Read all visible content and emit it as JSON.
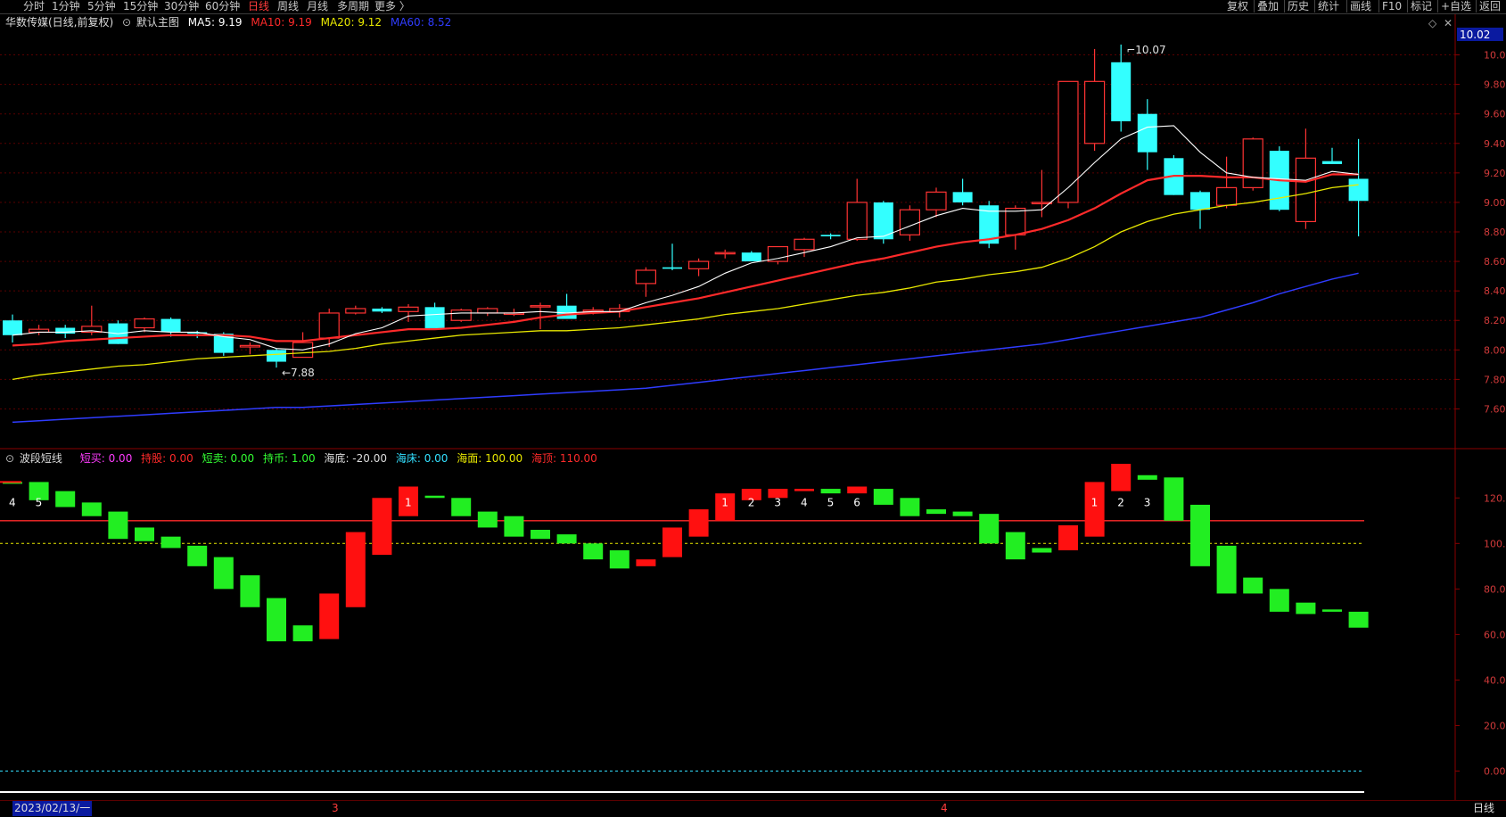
{
  "toolbar": {
    "left_tabs": [
      "分时",
      "1分钟",
      "5分钟",
      "15分钟",
      "30分钟",
      "60分钟",
      "日线",
      "周线",
      "月线",
      "多周期",
      "更多 〉"
    ],
    "active_tab": "日线",
    "right_tabs": [
      "复权",
      "叠加",
      "历史",
      "统计",
      "画线",
      "F10",
      "标记",
      "+自选",
      "返回"
    ]
  },
  "main_header": {
    "stock": "华数传媒(日线,前复权)",
    "template": "默认主图",
    "ma": [
      {
        "name": "MA5",
        "value": "9.19",
        "color": "#ffffff"
      },
      {
        "name": "MA10",
        "value": "9.19",
        "color": "#ff2a2a"
      },
      {
        "name": "MA20",
        "value": "9.12",
        "color": "#e8e800"
      },
      {
        "name": "MA60",
        "value": "8.52",
        "color": "#2f3cff"
      }
    ]
  },
  "sub_header": {
    "name": "波段短线",
    "items": [
      {
        "name": "短买",
        "value": "0.00",
        "color": "#ff3cff"
      },
      {
        "name": "持股",
        "value": "0.00",
        "color": "#ff2a2a"
      },
      {
        "name": "短卖",
        "value": "0.00",
        "color": "#33ff33"
      },
      {
        "name": "持币",
        "value": "1.00",
        "color": "#33ff33"
      },
      {
        "name": "海底",
        "value": "-20.00",
        "color": "#dddddd"
      },
      {
        "name": "海床",
        "value": "0.00",
        "color": "#33e0ff"
      },
      {
        "name": "海面",
        "value": "100.00",
        "color": "#e8e800"
      },
      {
        "name": "海顶",
        "value": "110.00",
        "color": "#ff2a2a"
      }
    ]
  },
  "price_badge": "10.02",
  "bottom": {
    "date_label": "2023/02/13/一",
    "month_labels": [
      "3",
      "4"
    ],
    "period_label": "日线"
  },
  "colors": {
    "up": "#ff3333",
    "down": "#33ffff",
    "bg": "#000000",
    "axis": "#8a0000",
    "grid": "#5a0000"
  },
  "chart_data": [
    {
      "type": "candlestick",
      "ylim": [
        7.5,
        10.1
      ],
      "yticks": [
        10.0,
        9.8,
        9.6,
        9.4,
        9.2,
        9.0,
        8.8,
        8.6,
        8.4,
        8.2,
        8.0,
        7.8,
        7.6
      ],
      "annotations": [
        {
          "text": "10.07",
          "index": 42
        },
        {
          "text": "7.88",
          "index": 10
        }
      ],
      "ohlc": [
        [
          8.2,
          8.24,
          8.05,
          8.1
        ],
        [
          8.12,
          8.17,
          8.1,
          8.14
        ],
        [
          8.15,
          8.17,
          8.08,
          8.11
        ],
        [
          8.12,
          8.3,
          8.1,
          8.16
        ],
        [
          8.18,
          8.2,
          8.04,
          8.04
        ],
        [
          8.15,
          8.22,
          8.12,
          8.21
        ],
        [
          8.21,
          8.22,
          8.09,
          8.12
        ],
        [
          8.12,
          8.13,
          8.08,
          8.11
        ],
        [
          8.11,
          8.12,
          7.96,
          7.98
        ],
        [
          8.02,
          8.05,
          7.97,
          8.03
        ],
        [
          8.0,
          8.01,
          7.88,
          7.92
        ],
        [
          7.95,
          8.12,
          7.95,
          8.05
        ],
        [
          8.08,
          8.28,
          8.02,
          8.25
        ],
        [
          8.25,
          8.3,
          8.24,
          8.28
        ],
        [
          8.28,
          8.29,
          8.25,
          8.26
        ],
        [
          8.26,
          8.31,
          8.19,
          8.29
        ],
        [
          8.29,
          8.32,
          8.14,
          8.14
        ],
        [
          8.2,
          8.28,
          8.19,
          8.27
        ],
        [
          8.25,
          8.29,
          8.23,
          8.28
        ],
        [
          8.25,
          8.28,
          8.23,
          8.25
        ],
        [
          8.3,
          8.32,
          8.14,
          8.3
        ],
        [
          8.3,
          8.38,
          8.24,
          8.21
        ],
        [
          8.26,
          8.29,
          8.24,
          8.27
        ],
        [
          8.26,
          8.31,
          8.22,
          8.28
        ],
        [
          8.45,
          8.56,
          8.36,
          8.54
        ],
        [
          8.56,
          8.72,
          8.54,
          8.55
        ],
        [
          8.55,
          8.62,
          8.5,
          8.6
        ],
        [
          8.66,
          8.68,
          8.62,
          8.66
        ],
        [
          8.66,
          8.67,
          8.61,
          8.6
        ],
        [
          8.6,
          8.7,
          8.58,
          8.7
        ],
        [
          8.68,
          8.76,
          8.63,
          8.75
        ],
        [
          8.78,
          8.79,
          8.75,
          8.77
        ],
        [
          8.75,
          9.16,
          8.74,
          9.0
        ],
        [
          9.0,
          9.01,
          8.72,
          8.75
        ],
        [
          8.78,
          8.98,
          8.74,
          8.95
        ],
        [
          8.95,
          9.1,
          8.9,
          9.07
        ],
        [
          9.07,
          9.16,
          8.98,
          9.0
        ],
        [
          8.98,
          9.01,
          8.69,
          8.72
        ],
        [
          8.78,
          8.98,
          8.68,
          8.96
        ],
        [
          9.0,
          9.22,
          8.9,
          9.0
        ],
        [
          9.0,
          9.76,
          8.96,
          9.82
        ],
        [
          9.4,
          10.04,
          9.35,
          9.82
        ],
        [
          9.95,
          10.07,
          9.48,
          9.55
        ],
        [
          9.6,
          9.7,
          9.22,
          9.34
        ],
        [
          9.3,
          9.32,
          9.05,
          9.05
        ],
        [
          9.07,
          9.08,
          8.82,
          8.95
        ],
        [
          8.98,
          9.31,
          8.96,
          9.1
        ],
        [
          9.1,
          9.44,
          9.08,
          9.43
        ],
        [
          9.35,
          9.38,
          8.94,
          8.95
        ],
        [
          8.87,
          9.5,
          8.82,
          9.3
        ],
        [
          9.28,
          9.37,
          9.26,
          9.26
        ],
        [
          9.16,
          9.43,
          8.77,
          9.01
        ]
      ],
      "ma5": [
        8.1,
        8.12,
        8.12,
        8.13,
        8.11,
        8.13,
        8.12,
        8.12,
        8.09,
        8.07,
        8.01,
        8.0,
        8.04,
        8.11,
        8.15,
        8.23,
        8.24,
        8.25,
        8.25,
        8.25,
        8.26,
        8.25,
        8.26,
        8.26,
        8.32,
        8.37,
        8.43,
        8.52,
        8.59,
        8.62,
        8.66,
        8.7,
        8.76,
        8.77,
        8.84,
        8.91,
        8.96,
        8.94,
        8.94,
        8.95,
        9.1,
        9.27,
        9.43,
        9.51,
        9.52,
        9.34,
        9.2,
        9.17,
        9.16,
        9.15,
        9.21,
        9.19
      ],
      "ma10": [
        8.03,
        8.04,
        8.06,
        8.07,
        8.08,
        8.09,
        8.1,
        8.1,
        8.1,
        8.09,
        8.06,
        8.06,
        8.08,
        8.1,
        8.12,
        8.14,
        8.14,
        8.15,
        8.17,
        8.19,
        8.22,
        8.24,
        8.25,
        8.26,
        8.29,
        8.32,
        8.35,
        8.39,
        8.43,
        8.47,
        8.51,
        8.55,
        8.59,
        8.62,
        8.66,
        8.7,
        8.73,
        8.75,
        8.78,
        8.82,
        8.88,
        8.96,
        9.06,
        9.15,
        9.18,
        9.18,
        9.17,
        9.17,
        9.15,
        9.14,
        9.19,
        9.19
      ],
      "ma20": [
        7.8,
        7.83,
        7.85,
        7.87,
        7.89,
        7.9,
        7.92,
        7.94,
        7.95,
        7.96,
        7.97,
        7.98,
        7.99,
        8.01,
        8.04,
        8.06,
        8.08,
        8.1,
        8.11,
        8.12,
        8.13,
        8.13,
        8.14,
        8.15,
        8.17,
        8.19,
        8.21,
        8.24,
        8.26,
        8.28,
        8.31,
        8.34,
        8.37,
        8.39,
        8.42,
        8.46,
        8.48,
        8.51,
        8.53,
        8.56,
        8.62,
        8.7,
        8.8,
        8.87,
        8.92,
        8.95,
        8.98,
        9.0,
        9.03,
        9.06,
        9.1,
        9.12
      ],
      "ma60": [
        7.51,
        7.52,
        7.53,
        7.54,
        7.55,
        7.56,
        7.57,
        7.58,
        7.59,
        7.6,
        7.61,
        7.61,
        7.62,
        7.63,
        7.64,
        7.65,
        7.66,
        7.67,
        7.68,
        7.69,
        7.7,
        7.71,
        7.72,
        7.73,
        7.74,
        7.76,
        7.78,
        7.8,
        7.82,
        7.84,
        7.86,
        7.88,
        7.9,
        7.92,
        7.94,
        7.96,
        7.98,
        8.0,
        8.02,
        8.04,
        8.07,
        8.1,
        8.13,
        8.16,
        8.19,
        8.22,
        8.27,
        8.32,
        8.38,
        8.43,
        8.48,
        8.52
      ]
    },
    {
      "type": "bar",
      "ylim": [
        -10,
        135
      ],
      "yticks": [
        120.0,
        100.0,
        80.0,
        60.0,
        40.0,
        20.0,
        0.0
      ],
      "reference_lines": [
        {
          "value": 110,
          "style": "solid"
        },
        {
          "value": 100,
          "style": "dashed"
        },
        {
          "value": 0,
          "style": "dashed"
        }
      ],
      "bars": [
        [
          127,
          127,
          0,
          "4"
        ],
        [
          127,
          119,
          0,
          "5"
        ],
        [
          123,
          116,
          0,
          ""
        ],
        [
          118,
          112,
          0,
          ""
        ],
        [
          114,
          102,
          0,
          ""
        ],
        [
          107,
          101,
          0,
          ""
        ],
        [
          103,
          98,
          0,
          ""
        ],
        [
          99,
          90,
          0,
          ""
        ],
        [
          94,
          80,
          0,
          ""
        ],
        [
          86,
          72,
          0,
          ""
        ],
        [
          76,
          57,
          0,
          ""
        ],
        [
          64,
          57,
          0,
          ""
        ],
        [
          58,
          78,
          1,
          ""
        ],
        [
          72,
          105,
          1,
          ""
        ],
        [
          95,
          120,
          1,
          ""
        ],
        [
          112,
          125,
          1,
          "1"
        ],
        [
          121,
          120,
          0,
          ""
        ],
        [
          120,
          112,
          0,
          ""
        ],
        [
          114,
          107,
          0,
          ""
        ],
        [
          112,
          103,
          0,
          ""
        ],
        [
          106,
          102,
          0,
          ""
        ],
        [
          104,
          100,
          0,
          ""
        ],
        [
          100,
          93,
          0,
          ""
        ],
        [
          97,
          89,
          0,
          ""
        ],
        [
          93,
          90,
          1,
          ""
        ],
        [
          94,
          107,
          1,
          ""
        ],
        [
          103,
          115,
          1,
          ""
        ],
        [
          110,
          122,
          1,
          "1"
        ],
        [
          119,
          124,
          1,
          "2"
        ],
        [
          120,
          124,
          1,
          "3"
        ],
        [
          123,
          124,
          1,
          "4"
        ],
        [
          124,
          122,
          0,
          "5"
        ],
        [
          122,
          125,
          1,
          "6"
        ],
        [
          124,
          117,
          0,
          ""
        ],
        [
          120,
          112,
          0,
          ""
        ],
        [
          115,
          113,
          0,
          ""
        ],
        [
          114,
          112,
          0,
          ""
        ],
        [
          113,
          100,
          0,
          ""
        ],
        [
          105,
          93,
          0,
          ""
        ],
        [
          98,
          96,
          0,
          ""
        ],
        [
          97,
          108,
          1,
          ""
        ],
        [
          103,
          127,
          1,
          "1"
        ],
        [
          123,
          135,
          1,
          "2"
        ],
        [
          130,
          128,
          0,
          "3"
        ],
        [
          129,
          110,
          0,
          ""
        ],
        [
          117,
          90,
          0,
          ""
        ],
        [
          99,
          78,
          0,
          ""
        ],
        [
          85,
          78,
          0,
          ""
        ],
        [
          80,
          70,
          0,
          ""
        ],
        [
          74,
          69,
          0,
          ""
        ],
        [
          71,
          70,
          0,
          ""
        ],
        [
          70,
          63,
          0,
          ""
        ]
      ]
    }
  ]
}
